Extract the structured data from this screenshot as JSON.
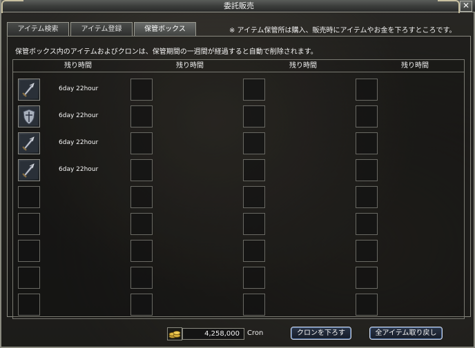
{
  "window": {
    "title": "委託販売",
    "close_glyph": "✕"
  },
  "tabs": [
    {
      "label": "アイテム検索",
      "active": false
    },
    {
      "label": "アイテム登録",
      "active": false
    },
    {
      "label": "保管ボックス",
      "active": true
    }
  ],
  "tab_note": "※ アイテム保管所は購入、販売時にアイテムやお金を下ろすところです。",
  "notice": "保管ボックス内のアイテムおよびクロンは、保管期間の一週間が経過すると自動で削除されます。",
  "columns": [
    {
      "header": "残り時間"
    },
    {
      "header": "残り時間"
    },
    {
      "header": "残り時間"
    },
    {
      "header": "残り時間"
    }
  ],
  "items": [
    {
      "time": "6day 22hour",
      "icon": "sword-icon"
    },
    {
      "time": "6day 22hour",
      "icon": "shield-icon"
    },
    {
      "time": "6day 22hour",
      "icon": "sword-icon"
    },
    {
      "time": "6day 22hour",
      "icon": "sword-icon"
    }
  ],
  "footer": {
    "money": "4,258,000",
    "currency": "Cron",
    "withdraw_cron_label": "クロンを下ろす",
    "withdraw_all_label": "全アイテム取り戻し"
  }
}
